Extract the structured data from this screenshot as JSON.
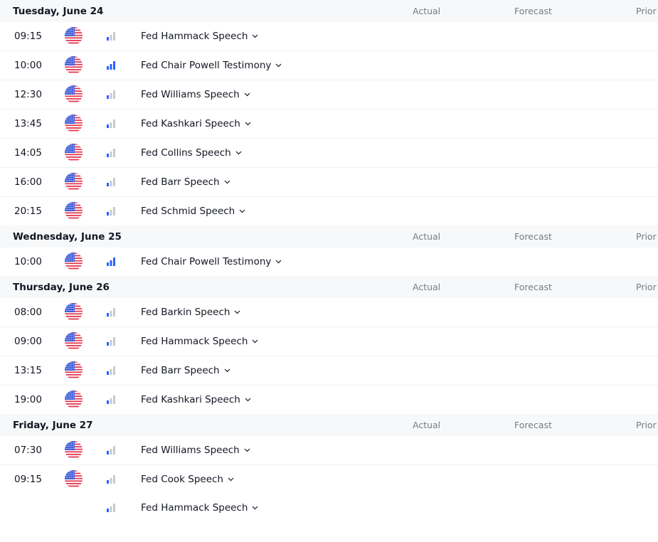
{
  "columns": {
    "actual": "Actual",
    "forecast": "Forecast",
    "prior": "Prior"
  },
  "colors": {
    "bar_active": "#2962ff",
    "bar_inactive": "#c7cad1",
    "header_bg": "#f7f8fa",
    "flag_red": "#e2384e",
    "flag_blue": "#3c5bd9"
  },
  "days": [
    {
      "title": "Tuesday, June 24",
      "events": [
        {
          "time": "09:15",
          "country": "us-flag-icon",
          "importance": 1,
          "title": "Fed Hammack Speech"
        },
        {
          "time": "10:00",
          "country": "us-flag-icon",
          "importance": 3,
          "title": "Fed Chair Powell Testimony"
        },
        {
          "time": "12:30",
          "country": "us-flag-icon",
          "importance": 1,
          "title": "Fed Williams Speech"
        },
        {
          "time": "13:45",
          "country": "us-flag-icon",
          "importance": 1,
          "title": "Fed Kashkari Speech"
        },
        {
          "time": "14:05",
          "country": "us-flag-icon",
          "importance": 1,
          "title": "Fed Collins Speech"
        },
        {
          "time": "16:00",
          "country": "us-flag-icon",
          "importance": 1,
          "title": "Fed Barr Speech"
        },
        {
          "time": "20:15",
          "country": "us-flag-icon",
          "importance": 1,
          "title": "Fed Schmid Speech"
        }
      ]
    },
    {
      "title": "Wednesday, June 25",
      "events": [
        {
          "time": "10:00",
          "country": "us-flag-icon",
          "importance": 3,
          "title": "Fed Chair Powell Testimony"
        }
      ]
    },
    {
      "title": "Thursday, June 26",
      "events": [
        {
          "time": "08:00",
          "country": "us-flag-icon",
          "importance": 1,
          "title": "Fed Barkin Speech"
        },
        {
          "time": "09:00",
          "country": "us-flag-icon",
          "importance": 1,
          "title": "Fed Hammack Speech"
        },
        {
          "time": "13:15",
          "country": "us-flag-icon",
          "importance": 1,
          "title": "Fed Barr Speech"
        },
        {
          "time": "19:00",
          "country": "us-flag-icon",
          "importance": 1,
          "title": "Fed Kashkari Speech"
        }
      ]
    },
    {
      "title": "Friday, June 27",
      "events": [
        {
          "time": "07:30",
          "country": "us-flag-icon",
          "importance": 1,
          "title": "Fed Williams Speech"
        },
        {
          "time": "09:15",
          "country": "us-flag-icon",
          "importance": 1,
          "title": "Fed Cook Speech"
        },
        {
          "time": "",
          "country": "",
          "importance": 1,
          "title": "Fed Hammack Speech"
        }
      ]
    }
  ]
}
